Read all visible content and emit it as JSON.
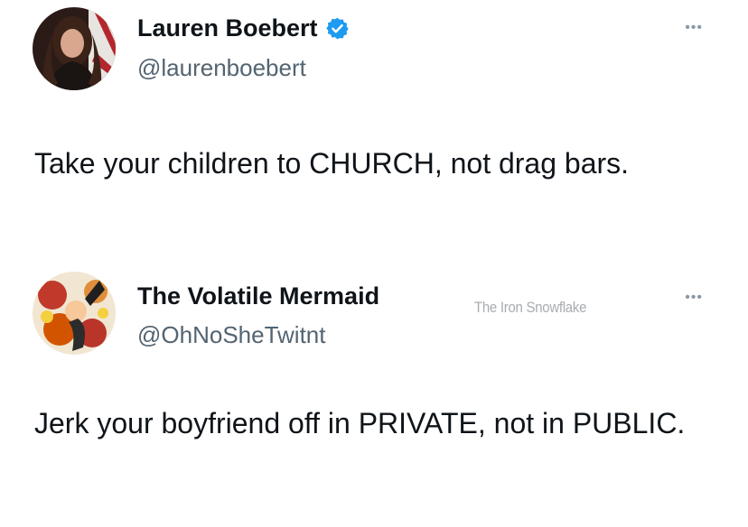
{
  "tweets": [
    {
      "display_name": "Lauren Boebert",
      "handle": "@laurenboebert",
      "verified": true,
      "text": "Take your children to CHURCH, not drag bars.",
      "more_icon": "more-options-icon"
    },
    {
      "display_name": "The Volatile Mermaid",
      "handle": "@OhNoSheTwitnt",
      "verified": false,
      "text": "Jerk your boyfriend off in PRIVATE, not in PUBLIC.",
      "more_icon": "more-options-icon"
    }
  ],
  "watermark": "The Iron Snowflake",
  "colors": {
    "text": "#0f1419",
    "secondary": "#536471",
    "verified_blue": "#1d9bf0"
  }
}
